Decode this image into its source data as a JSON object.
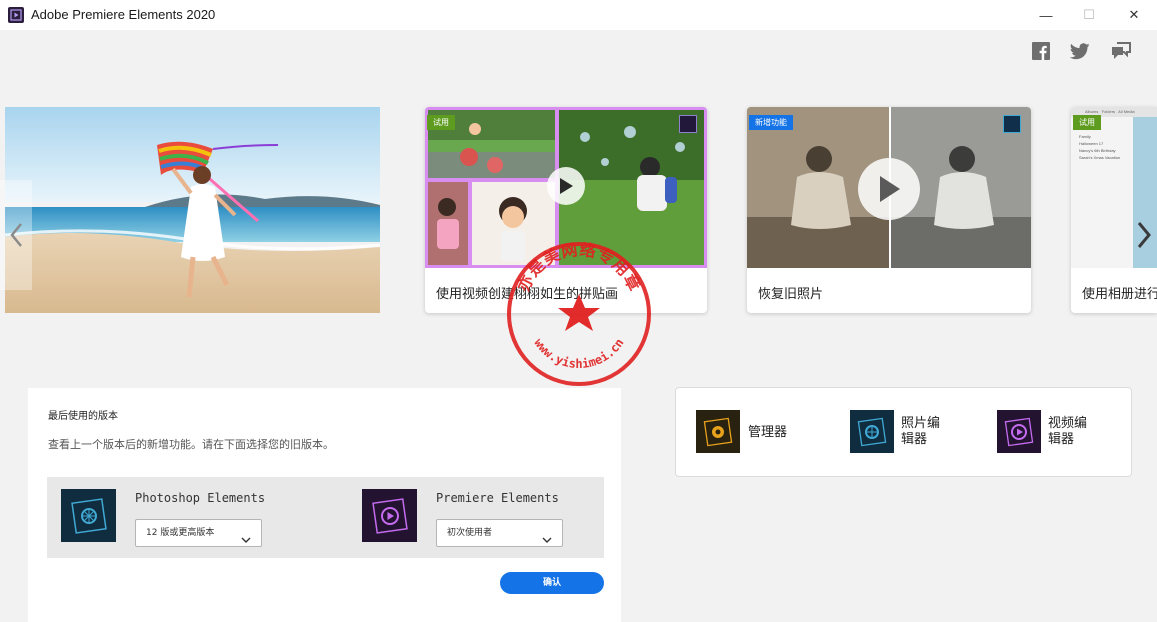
{
  "window": {
    "title": "Adobe Premiere Elements 2020",
    "minimize": "—",
    "maximize": "☐",
    "close": "✕"
  },
  "social": {
    "facebook_icon": "facebook-icon",
    "twitter_icon": "twitter-icon",
    "feedback_icon": "feedback-icon"
  },
  "carousel": {
    "cards": [
      {
        "badge": "试用",
        "label": "使用视频创建栩栩如生的拼贴画"
      },
      {
        "badge": "新增功能",
        "label": "恢复旧照片"
      },
      {
        "badge": "试用",
        "label": "使用相册进行"
      }
    ],
    "album_mini": {
      "tabs": [
        "Albums",
        "Folders",
        "All Media"
      ],
      "items": [
        "Family",
        "Halloween 17",
        "Nancy's 6th Birthday",
        "Sarah's Xmas Vacation"
      ]
    }
  },
  "last_version": {
    "title": "最后使用的版本",
    "description": "查看上一个版本后的新增功能。请在下面选择您的旧版本。",
    "products": [
      {
        "name": "Photoshop Elements",
        "selected": "12 版或更高版本"
      },
      {
        "name": "Premiere Elements",
        "selected": "初次使用者"
      }
    ],
    "confirm_label": "确认"
  },
  "launchers": [
    {
      "label": "管理器"
    },
    {
      "label": "照片编辑器"
    },
    {
      "label": "视频编辑器"
    }
  ],
  "watermark": {
    "text": "亦是美网络专用章",
    "url": "www.yishimei.cn"
  },
  "colors": {
    "accent": "#1473e6",
    "badge_green": "#5e9c1f",
    "stamp_red": "#e02020",
    "collage_border": "#d88df0"
  }
}
